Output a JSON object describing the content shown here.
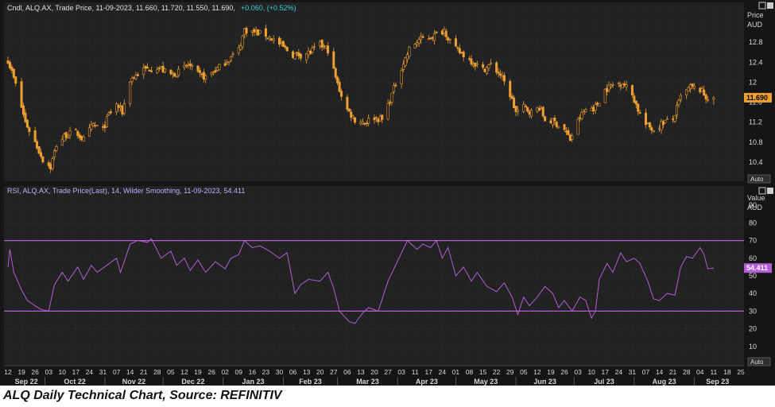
{
  "colors": {
    "background": "#151515",
    "plot_background": "#222222",
    "grid": "#3a3a3a",
    "axis_text": "#d8d8d8",
    "price_candle": "#f0a030",
    "rsi_line": "#b45cd6",
    "rsi_bands": "#b45cd6",
    "info_text": "#e0e0e0",
    "change_text": "#36d0d8",
    "rsi_info_text": "#b4b4ff",
    "price_tag_bg": "#f0a030",
    "rsi_tag_bg": "#b45cd6"
  },
  "price_panel": {
    "info_series": "Cndl, ALQ.AX, Trade Price, 11-09-2023, 11.660, 11.720, 11.550, 11.690,",
    "info_change": "+0.060, (+0.52%)",
    "axis_title_1": "Price",
    "axis_title_2": "AUD",
    "last_value": "11.690",
    "auto_label": "Auto"
  },
  "rsi_panel": {
    "info_series": "RSI, ALQ.AX, Trade Price(Last), 14, Wilder Smoothing, 11-09-2023, 54.411",
    "axis_title_1": "Value",
    "axis_title_2": "AUD",
    "last_value": "54.411",
    "auto_label": "Auto"
  },
  "x_axis": {
    "day_ticks": [
      "12",
      "19",
      "26",
      "03",
      "10",
      "17",
      "24",
      "31",
      "07",
      "14",
      "21",
      "28",
      "05",
      "12",
      "19",
      "26",
      "02",
      "09",
      "16",
      "23",
      "30",
      "06",
      "13",
      "20",
      "27",
      "06",
      "13",
      "20",
      "27",
      "03",
      "11",
      "17",
      "24",
      "01",
      "08",
      "15",
      "22",
      "29",
      "05",
      "12",
      "19",
      "26",
      "03",
      "10",
      "17",
      "24",
      "31",
      "07",
      "14",
      "21",
      "28",
      "04",
      "11",
      "18",
      "25"
    ],
    "month_labels": [
      "Sep 22",
      "Oct 22",
      "Nov 22",
      "Dec 22",
      "Jan 23",
      "Feb 23",
      "Mar 23",
      "Apr 23",
      "May 23",
      "Jun 23",
      "Jul 23",
      "Aug 23",
      "Sep 23"
    ]
  },
  "caption": "ALQ Daily Technical Chart, Source: REFINITIV",
  "chart_data": [
    {
      "type": "candlestick",
      "ylabel": "Price AUD",
      "ylim": [
        10.05,
        13.55
      ],
      "yticks": [
        10.4,
        10.8,
        11.2,
        11.6,
        12,
        12.4,
        12.8
      ],
      "grid": true,
      "last": {
        "date": "2023-09-11",
        "open": 11.66,
        "high": 11.72,
        "low": 11.55,
        "close": 11.69
      },
      "x_start": "2022-09-12",
      "x_end": "2023-09-25",
      "close_series": [
        [
          "2022-09-12",
          12.45
        ],
        [
          "2022-09-16",
          11.95
        ],
        [
          "2022-09-21",
          11.2
        ],
        [
          "2022-09-26",
          10.8
        ],
        [
          "2022-09-30",
          10.45
        ],
        [
          "2022-10-04",
          10.3
        ],
        [
          "2022-10-07",
          10.75
        ],
        [
          "2022-10-12",
          10.95
        ],
        [
          "2022-10-17",
          11.0
        ],
        [
          "2022-10-21",
          10.85
        ],
        [
          "2022-10-26",
          11.15
        ],
        [
          "2022-10-31",
          11.05
        ],
        [
          "2022-11-03",
          11.35
        ],
        [
          "2022-11-07",
          11.55
        ],
        [
          "2022-11-10",
          11.4
        ],
        [
          "2022-11-14",
          12.05
        ],
        [
          "2022-11-21",
          12.25
        ],
        [
          "2022-11-28",
          12.3
        ],
        [
          "2022-12-05",
          12.15
        ],
        [
          "2022-12-09",
          12.2
        ],
        [
          "2022-12-14",
          12.35
        ],
        [
          "2022-12-19",
          12.15
        ],
        [
          "2022-12-23",
          12.1
        ],
        [
          "2022-12-30",
          12.3
        ],
        [
          "2023-01-05",
          12.5
        ],
        [
          "2023-01-09",
          12.65
        ],
        [
          "2023-01-12",
          13.05
        ],
        [
          "2023-01-17",
          13.0
        ],
        [
          "2023-01-23",
          12.95
        ],
        [
          "2023-01-27",
          12.85
        ],
        [
          "2023-02-01",
          12.7
        ],
        [
          "2023-02-06",
          12.55
        ],
        [
          "2023-02-10",
          12.55
        ],
        [
          "2023-02-15",
          12.6
        ],
        [
          "2023-02-20",
          12.75
        ],
        [
          "2023-02-24",
          12.65
        ],
        [
          "2023-03-01",
          11.95
        ],
        [
          "2023-03-06",
          11.45
        ],
        [
          "2023-03-10",
          11.25
        ],
        [
          "2023-03-15",
          11.2
        ],
        [
          "2023-03-20",
          11.3
        ],
        [
          "2023-03-24",
          11.25
        ],
        [
          "2023-03-28",
          11.65
        ],
        [
          "2023-04-03",
          12.3
        ],
        [
          "2023-04-07",
          12.65
        ],
        [
          "2023-04-12",
          12.85
        ],
        [
          "2023-04-17",
          12.9
        ],
        [
          "2023-04-21",
          12.95
        ],
        [
          "2023-04-25",
          13.05
        ],
        [
          "2023-04-27",
          12.9
        ],
        [
          "2023-05-01",
          12.65
        ],
        [
          "2023-05-05",
          12.55
        ],
        [
          "2023-05-10",
          12.4
        ],
        [
          "2023-05-15",
          12.25
        ],
        [
          "2023-05-19",
          12.35
        ],
        [
          "2023-05-24",
          12.15
        ],
        [
          "2023-05-29",
          11.75
        ],
        [
          "2023-06-01",
          11.4
        ],
        [
          "2023-06-05",
          11.5
        ],
        [
          "2023-06-09",
          11.4
        ],
        [
          "2023-06-13",
          11.5
        ],
        [
          "2023-06-16",
          11.25
        ],
        [
          "2023-06-21",
          11.2
        ],
        [
          "2023-06-26",
          11.05
        ],
        [
          "2023-06-29",
          10.85
        ],
        [
          "2023-07-04",
          11.3
        ],
        [
          "2023-07-07",
          11.45
        ],
        [
          "2023-07-12",
          11.5
        ],
        [
          "2023-07-17",
          11.85
        ],
        [
          "2023-07-21",
          11.95
        ],
        [
          "2023-07-26",
          12.0
        ],
        [
          "2023-07-31",
          11.75
        ],
        [
          "2023-08-03",
          11.45
        ],
        [
          "2023-08-07",
          11.15
        ],
        [
          "2023-08-11",
          11.05
        ],
        [
          "2023-08-16",
          11.2
        ],
        [
          "2023-08-21",
          11.25
        ],
        [
          "2023-08-25",
          11.7
        ],
        [
          "2023-08-30",
          11.9
        ],
        [
          "2023-09-04",
          11.85
        ],
        [
          "2023-09-07",
          11.7
        ],
        [
          "2023-09-11",
          11.69
        ]
      ]
    },
    {
      "type": "line",
      "title": "RSI, ALQ.AX, Trade Price(Last), 14, Wilder Smoothing",
      "ylabel": "Value",
      "ylim": [
        0,
        100
      ],
      "yticks": [
        10,
        20,
        30,
        40,
        50,
        60,
        70,
        80,
        90
      ],
      "reference_lines": [
        30,
        70
      ],
      "grid": true,
      "last": {
        "date": "2023-09-11",
        "value": 54.411
      },
      "x_start": "2022-09-12",
      "x_end": "2023-09-25",
      "series": [
        {
          "points": [
            [
              "2022-09-12",
              55
            ],
            [
              "2022-09-13",
              65
            ],
            [
              "2022-09-15",
              52
            ],
            [
              "2022-09-19",
              42
            ],
            [
              "2022-09-22",
              36
            ],
            [
              "2022-09-26",
              33
            ],
            [
              "2022-09-29",
              31
            ],
            [
              "2022-10-03",
              30
            ],
            [
              "2022-10-06",
              45
            ],
            [
              "2022-10-10",
              52
            ],
            [
              "2022-10-13",
              47
            ],
            [
              "2022-10-18",
              55
            ],
            [
              "2022-10-21",
              48
            ],
            [
              "2022-10-25",
              56
            ],
            [
              "2022-10-28",
              52
            ],
            [
              "2022-11-02",
              56
            ],
            [
              "2022-11-07",
              60
            ],
            [
              "2022-11-09",
              52
            ],
            [
              "2022-11-11",
              58
            ],
            [
              "2022-11-14",
              68
            ],
            [
              "2022-11-18",
              70
            ],
            [
              "2022-11-23",
              69
            ],
            [
              "2022-11-25",
              71
            ],
            [
              "2022-11-30",
              60
            ],
            [
              "2022-12-05",
              64
            ],
            [
              "2022-12-08",
              56
            ],
            [
              "2022-12-12",
              60
            ],
            [
              "2022-12-15",
              53
            ],
            [
              "2022-12-19",
              59
            ],
            [
              "2022-12-23",
              52
            ],
            [
              "2022-12-28",
              58
            ],
            [
              "2023-01-02",
              54
            ],
            [
              "2023-01-05",
              60
            ],
            [
              "2023-01-09",
              62
            ],
            [
              "2023-01-12",
              70
            ],
            [
              "2023-01-16",
              66
            ],
            [
              "2023-01-20",
              67
            ],
            [
              "2023-01-25",
              64
            ],
            [
              "2023-01-30",
              60
            ],
            [
              "2023-02-03",
              63
            ],
            [
              "2023-02-07",
              40
            ],
            [
              "2023-02-10",
              45
            ],
            [
              "2023-02-14",
              48
            ],
            [
              "2023-02-20",
              47
            ],
            [
              "2023-02-24",
              52
            ],
            [
              "2023-02-27",
              43
            ],
            [
              "2023-03-02",
              30
            ],
            [
              "2023-03-07",
              24
            ],
            [
              "2023-03-10",
              23
            ],
            [
              "2023-03-14",
              29
            ],
            [
              "2023-03-17",
              32
            ],
            [
              "2023-03-22",
              30
            ],
            [
              "2023-03-27",
              47
            ],
            [
              "2023-04-03",
              63
            ],
            [
              "2023-04-06",
              70
            ],
            [
              "2023-04-11",
              65
            ],
            [
              "2023-04-14",
              68
            ],
            [
              "2023-04-18",
              66
            ],
            [
              "2023-04-21",
              70
            ],
            [
              "2023-04-24",
              60
            ],
            [
              "2023-04-27",
              66
            ],
            [
              "2023-05-01",
              50
            ],
            [
              "2023-05-05",
              55
            ],
            [
              "2023-05-09",
              47
            ],
            [
              "2023-05-12",
              52
            ],
            [
              "2023-05-17",
              44
            ],
            [
              "2023-05-22",
              41
            ],
            [
              "2023-05-26",
              46
            ],
            [
              "2023-05-30",
              38
            ],
            [
              "2023-06-02",
              28
            ],
            [
              "2023-06-05",
              38
            ],
            [
              "2023-06-08",
              33
            ],
            [
              "2023-06-12",
              38
            ],
            [
              "2023-06-16",
              44
            ],
            [
              "2023-06-20",
              40
            ],
            [
              "2023-06-23",
              32
            ],
            [
              "2023-06-26",
              36
            ],
            [
              "2023-06-30",
              30
            ],
            [
              "2023-07-04",
              38
            ],
            [
              "2023-07-07",
              36
            ],
            [
              "2023-07-10",
              26
            ],
            [
              "2023-07-12",
              30
            ],
            [
              "2023-07-14",
              48
            ],
            [
              "2023-07-18",
              57
            ],
            [
              "2023-07-21",
              52
            ],
            [
              "2023-07-25",
              63
            ],
            [
              "2023-07-28",
              58
            ],
            [
              "2023-08-01",
              60
            ],
            [
              "2023-08-04",
              57
            ],
            [
              "2023-08-08",
              47
            ],
            [
              "2023-08-11",
              37
            ],
            [
              "2023-08-14",
              36
            ],
            [
              "2023-08-18",
              40
            ],
            [
              "2023-08-22",
              39
            ],
            [
              "2023-08-25",
              55
            ],
            [
              "2023-08-28",
              61
            ],
            [
              "2023-08-31",
              60
            ],
            [
              "2023-09-04",
              66
            ],
            [
              "2023-09-06",
              62
            ],
            [
              "2023-09-08",
              54
            ],
            [
              "2023-09-11",
              54.411
            ]
          ]
        }
      ]
    }
  ]
}
